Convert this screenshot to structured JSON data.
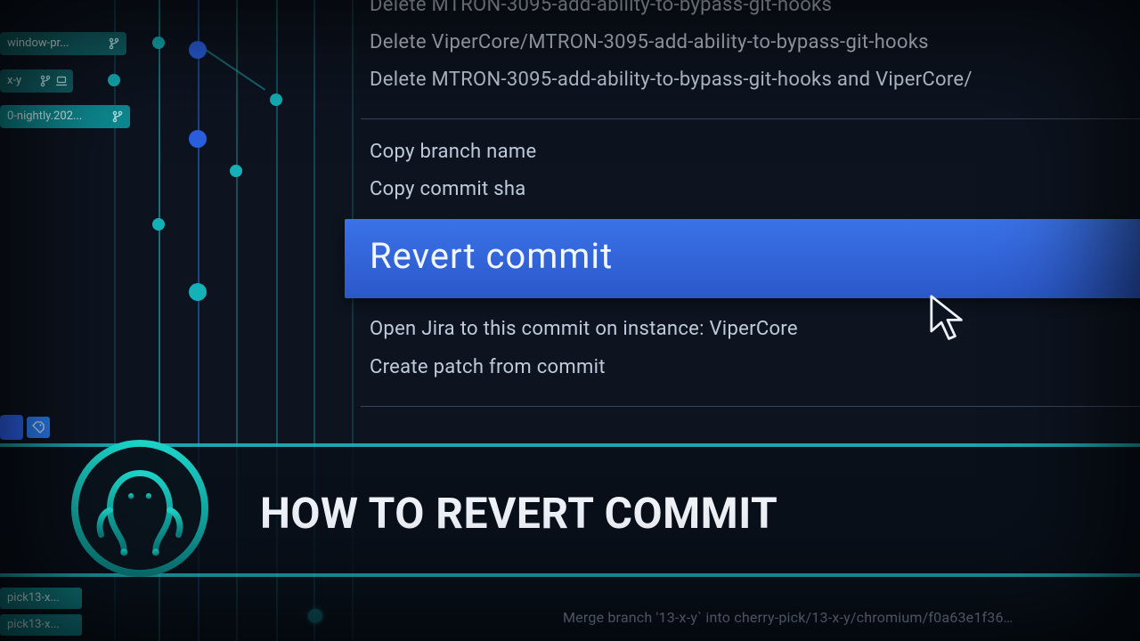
{
  "menu": {
    "delete1": "Delete MTRON-3095-add-ability-to-bypass-git-hooks",
    "delete2": "Delete ViperCore/MTRON-3095-add-ability-to-bypass-git-hooks",
    "delete3": "Delete MTRON-3095-add-ability-to-bypass-git-hooks and ViperCore/",
    "copy_branch": "Copy branch name",
    "copy_sha": "Copy commit sha",
    "revert": "Revert commit",
    "open_jira": "Open Jira to this commit on instance:  ViperCore",
    "create_patch": "Create patch from commit"
  },
  "tags": {
    "window": "window-pr...",
    "xy": "x-y",
    "nightly": "0-nightly.202..."
  },
  "pick_tags": {
    "a": "pick13-x...",
    "b": "pick13-x..."
  },
  "commit_line": "Merge branch '13-x-y` into cherry-pick/13-x-y/chromium/f0a63e1f36…",
  "title": "HOW TO REVERT COMMIT"
}
